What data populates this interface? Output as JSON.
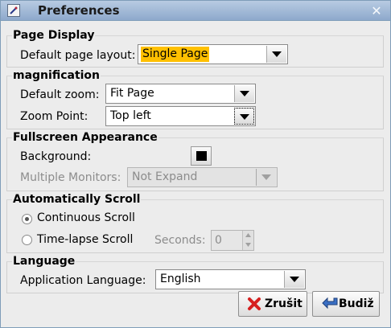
{
  "window": {
    "title": "Preferences",
    "close_symbol": "✕",
    "app_icon": "edit-document-icon"
  },
  "page_display": {
    "title": "Page Display",
    "layout_label": "Default page layout:",
    "layout_value": "Single Page"
  },
  "magnification": {
    "title": "magnification",
    "zoom_label": "Default zoom:",
    "zoom_value": "Fit Page",
    "point_label": "Zoom Point:",
    "point_value": "Top left"
  },
  "fullscreen": {
    "title": "Fullscreen Appearance",
    "background_label": "Background:",
    "background_color": "#000000",
    "monitors_label": "Multiple Monitors:",
    "monitors_value": "Not Expand"
  },
  "scroll": {
    "title": "Automatically Scroll",
    "continuous_label": "Continuous Scroll",
    "continuous_selected": true,
    "timelapse_label": "Time-lapse Scroll",
    "timelapse_selected": false,
    "seconds_label": "Seconds:",
    "seconds_value": "0"
  },
  "language": {
    "title": "Language",
    "app_language_label": "Application Language:",
    "app_language_value": "English"
  },
  "buttons": {
    "cancel_label": "Zrušit",
    "save_label": "Budiž"
  },
  "colors": {
    "highlight": "#ffc000",
    "cancel_icon": "#d62020",
    "save_icon": "#3a6fc4"
  }
}
